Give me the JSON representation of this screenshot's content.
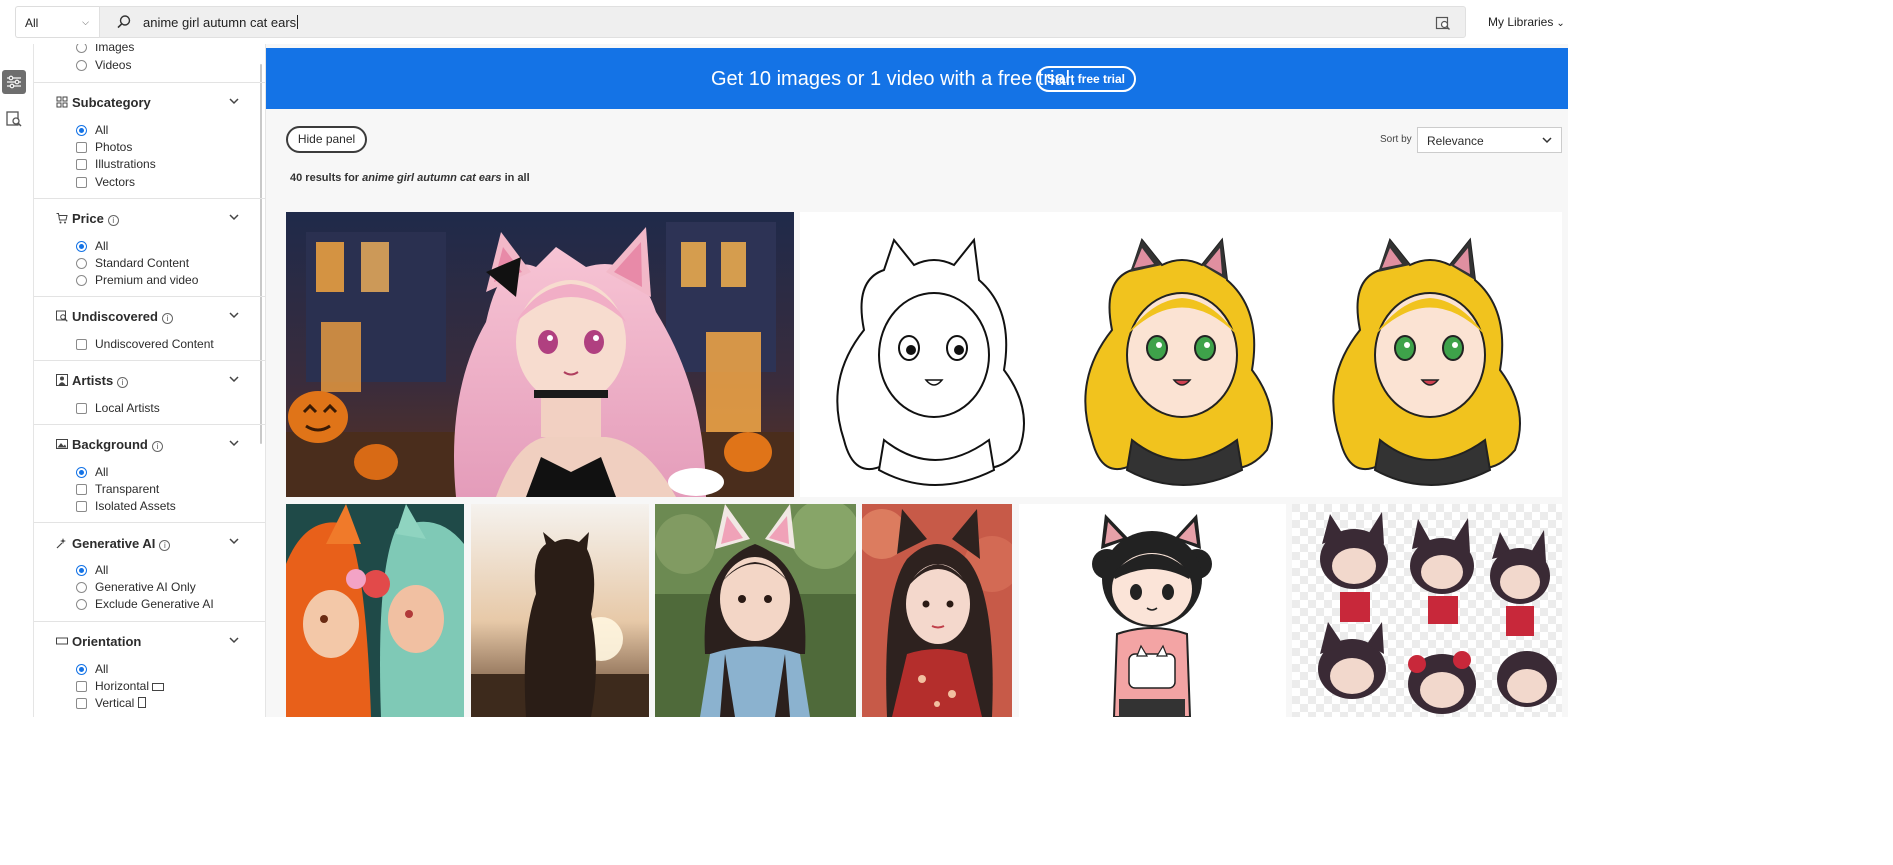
{
  "search": {
    "scope": "All",
    "query": "anime girl autumn cat ears",
    "my_libraries": "My Libraries"
  },
  "filters": {
    "type_partial": [
      "Images",
      "Videos"
    ],
    "subcategory": {
      "title": "Subcategory",
      "options": [
        "All",
        "Photos",
        "Illustrations",
        "Vectors"
      ],
      "selected": "All"
    },
    "price": {
      "title": "Price",
      "options": [
        "All",
        "Standard Content",
        "Premium and video"
      ],
      "selected": "All"
    },
    "undiscovered": {
      "title": "Undiscovered",
      "options": [
        "Undiscovered Content"
      ]
    },
    "artists": {
      "title": "Artists",
      "options": [
        "Local Artists"
      ]
    },
    "background": {
      "title": "Background",
      "options": [
        "All",
        "Transparent",
        "Isolated Assets"
      ],
      "selected": "All"
    },
    "generative_ai": {
      "title": "Generative AI",
      "options": [
        "All",
        "Generative AI Only",
        "Exclude Generative AI"
      ],
      "selected": "All"
    },
    "orientation": {
      "title": "Orientation",
      "options": [
        "All",
        "Horizontal",
        "Vertical"
      ],
      "selected": "All"
    }
  },
  "banner": {
    "text": "Get 10 images or 1 video with a free trial.",
    "button": "Start free trial"
  },
  "toolbar": {
    "hide_panel": "Hide panel",
    "sort_label": "Sort by",
    "sort_value": "Relevance"
  },
  "results": {
    "prefix": "40 results for",
    "query": "anime girl autumn cat ears",
    "suffix": "in all"
  },
  "colors": {
    "accent": "#1473e6",
    "banner": "#1473e6"
  }
}
